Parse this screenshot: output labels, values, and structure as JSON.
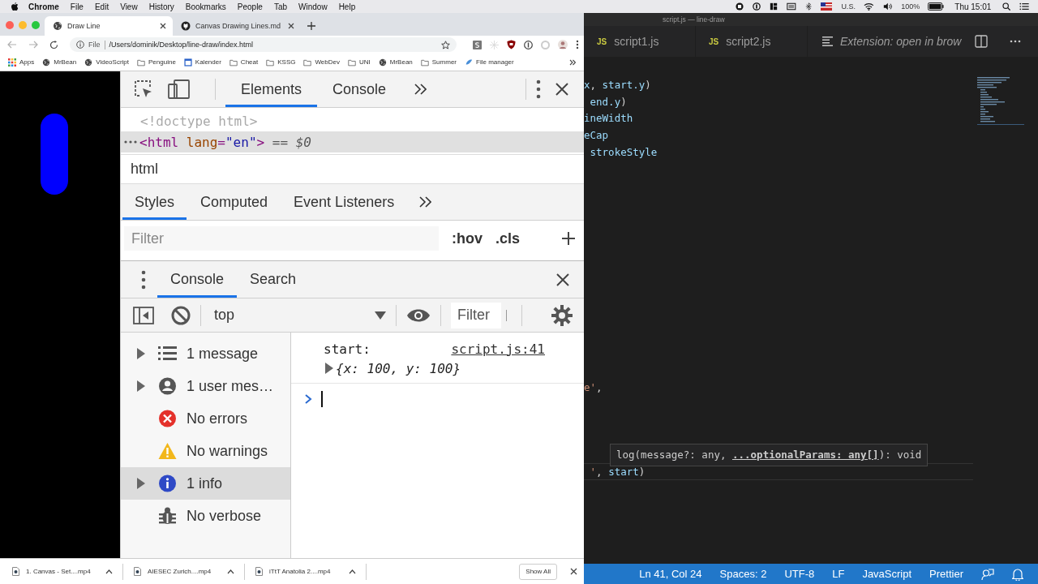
{
  "menu_bar": {
    "app": "Chrome",
    "items": [
      "File",
      "Edit",
      "View",
      "History",
      "Bookmarks",
      "People",
      "Tab",
      "Window",
      "Help"
    ],
    "keyboard": "U.S.",
    "battery": "100%",
    "clock": "Thu 15:01"
  },
  "browser": {
    "tabs": [
      {
        "title": "Draw Line",
        "selected": true,
        "kind": "site"
      },
      {
        "title": "Canvas Drawing Lines.md",
        "selected": false,
        "kind": "repo"
      }
    ],
    "address": {
      "scheme": "File",
      "url": "/Users/dominik/Desktop/line-draw/index.html"
    },
    "bookmarks": [
      {
        "label": "Apps",
        "kind": "apps"
      },
      {
        "label": "MrBean",
        "kind": "globe"
      },
      {
        "label": "VideoScript",
        "kind": "globe"
      },
      {
        "label": "Penguine",
        "kind": "folder"
      },
      {
        "label": "Kalender",
        "kind": "calendar"
      },
      {
        "label": "Cheat",
        "kind": "folder"
      },
      {
        "label": "KSSG",
        "kind": "folder"
      },
      {
        "label": "WebDev",
        "kind": "folder"
      },
      {
        "label": "UNI",
        "kind": "folder"
      },
      {
        "label": "MrBean",
        "kind": "globe"
      },
      {
        "label": "Summer",
        "kind": "folder"
      },
      {
        "label": "File manager",
        "kind": "app"
      }
    ],
    "devtools": {
      "main_tabs": [
        {
          "label": "Elements",
          "selected": true
        },
        {
          "label": "Console",
          "selected": false
        }
      ],
      "dom_lines": [
        {
          "kind": "doctype",
          "text": "<!doctype html>",
          "selected": false
        },
        {
          "kind": "element",
          "tag": "<html",
          "attr": "lang",
          "eq": "=",
          "value": "\"en\"",
          "close": ">",
          "suffix": "== $0",
          "selected": true
        }
      ],
      "breadcrumb": "html",
      "style_tabs": [
        {
          "label": "Styles",
          "selected": true
        },
        {
          "label": "Computed",
          "selected": false
        },
        {
          "label": "Event Listeners",
          "selected": false
        }
      ],
      "styles_filter": {
        "placeholder": "Filter"
      },
      "hov": ":hov",
      "cls": ".cls",
      "drawer_tabs": [
        {
          "label": "Console",
          "selected": true
        },
        {
          "label": "Search",
          "selected": false
        }
      ],
      "context": "top",
      "console_filter": {
        "placeholder": "Filter"
      },
      "sidebar": [
        {
          "label": "1 message",
          "kind": "list",
          "expandable": true,
          "selected": false
        },
        {
          "label": "1 user mes…",
          "kind": "user",
          "expandable": true,
          "selected": false
        },
        {
          "label": "No errors",
          "kind": "error",
          "expandable": false,
          "selected": false
        },
        {
          "label": "No warnings",
          "kind": "warning",
          "expandable": false,
          "selected": false
        },
        {
          "label": "1 info",
          "kind": "info",
          "expandable": true,
          "selected": true
        },
        {
          "label": "No verbose",
          "kind": "bug",
          "expandable": false,
          "selected": false
        }
      ],
      "messages": [
        {
          "text": "start:",
          "source": "script.js:41",
          "object": "{x: 100, y: 100}",
          "expanded": false
        }
      ]
    },
    "downloads": {
      "items": [
        "1. Canvas - Set....mp4",
        "AIESEC Zurich....mp4",
        "iTtT Anatolia 2....mp4"
      ],
      "show_all": "Show All"
    }
  },
  "editor": {
    "window_title": "script.js — line-draw",
    "tabs": [
      {
        "label": "script1.js",
        "kind": "js",
        "badge": "JS"
      },
      {
        "label": "script2.js",
        "kind": "js",
        "badge": "JS"
      },
      {
        "label": "Extension: open in brow",
        "kind": "preview"
      }
    ],
    "code_lines": [
      {
        "current": false,
        "segments": [
          {
            "text": "x",
            "kind": "ident"
          },
          {
            "text": ", ",
            "kind": "punct"
          },
          {
            "text": "start.y",
            "kind": "ident"
          },
          {
            "text": ")",
            "kind": "punct"
          }
        ]
      },
      {
        "current": false,
        "segments": [
          {
            "text": " end.y",
            "kind": "ident"
          },
          {
            "text": ")",
            "kind": "punct"
          }
        ]
      },
      {
        "current": false,
        "segments": [
          {
            "text": "ineWidth",
            "kind": "ident"
          }
        ]
      },
      {
        "current": false,
        "segments": [
          {
            "text": "eCap",
            "kind": "ident"
          }
        ]
      },
      {
        "current": false,
        "segments": [
          {
            "text": " strokeStyle",
            "kind": "ident"
          }
        ]
      },
      {
        "current": false,
        "segments": [
          {
            "text": "e'",
            "kind": "string"
          },
          {
            "text": ",",
            "kind": "punct"
          }
        ]
      },
      {
        "current": true,
        "segments": [
          {
            "text": " '",
            "kind": "string"
          },
          {
            "text": ", ",
            "kind": "punct"
          },
          {
            "text": "start",
            "kind": "ident"
          },
          {
            "text": ")",
            "kind": "punct"
          }
        ]
      }
    ],
    "hover_hint": "log(message?: any, **...optionalParams: any[]**): void",
    "status_bar": [
      "Ln 41, Col 24",
      "Spaces: 2",
      "UTF-8",
      "LF",
      "JavaScript",
      "Prettier"
    ]
  }
}
